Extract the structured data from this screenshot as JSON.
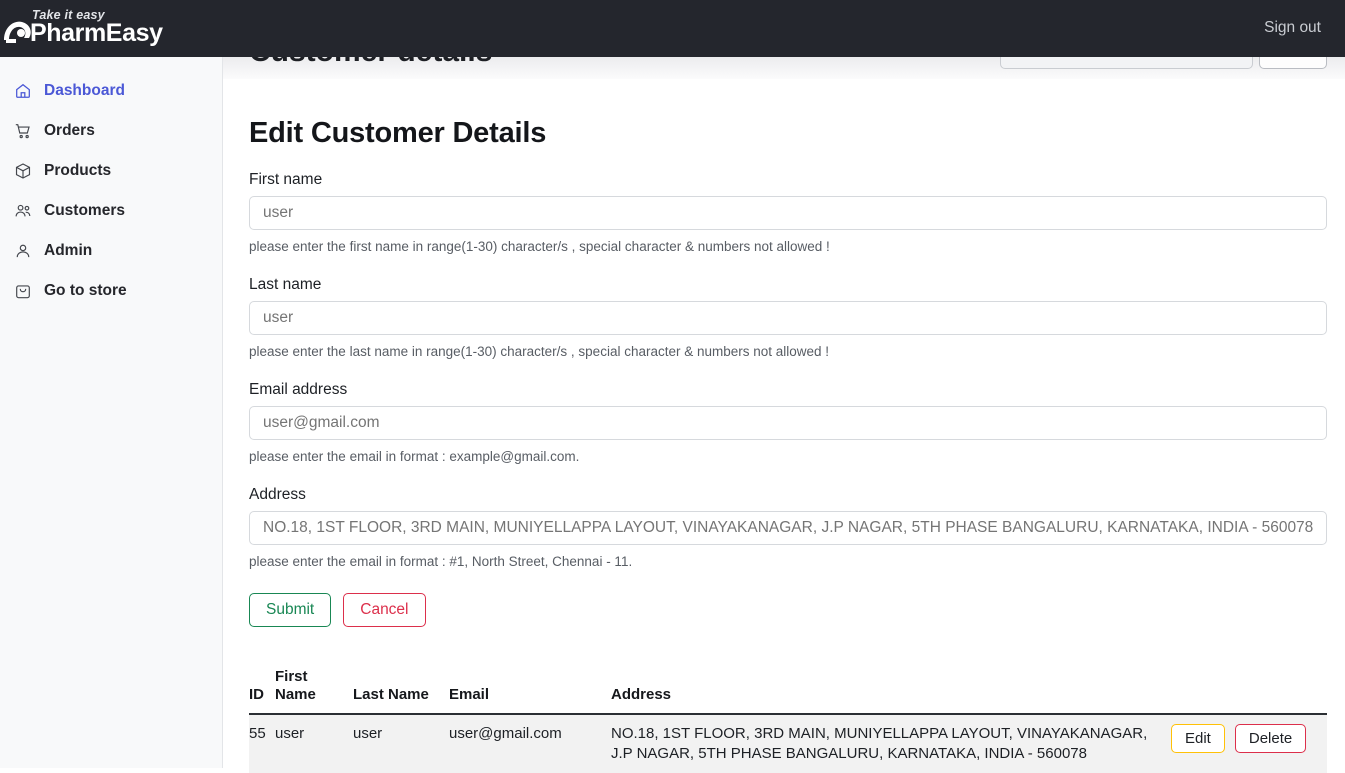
{
  "header": {
    "brand_tagline": "Take it easy",
    "brand_name": "PharmEasy",
    "signout_label": "Sign out"
  },
  "sidebar": {
    "items": [
      {
        "label": "Dashboard",
        "icon": "home-icon",
        "active": true
      },
      {
        "label": "Orders",
        "icon": "cart-icon",
        "active": false
      },
      {
        "label": "Products",
        "icon": "box-icon",
        "active": false
      },
      {
        "label": "Customers",
        "icon": "users-icon",
        "active": false
      },
      {
        "label": "Admin",
        "icon": "user-icon",
        "active": false
      },
      {
        "label": "Go to store",
        "icon": "bag-icon",
        "active": false
      }
    ]
  },
  "page": {
    "title": "Customer details"
  },
  "form": {
    "title": "Edit Customer Details",
    "fields": [
      {
        "label": "First name",
        "value": "user",
        "placeholder": "user",
        "help": "please enter the first name in range(1-30) character/s , special character & numbers not allowed !"
      },
      {
        "label": "Last name",
        "value": "user",
        "placeholder": "user",
        "help": "please enter the last name in range(1-30) character/s , special character & numbers not allowed !"
      },
      {
        "label": "Email address",
        "value": "user@gmail.com",
        "placeholder": "user@gmail.com",
        "help": "please enter the email in format : example@gmail.com."
      },
      {
        "label": "Address",
        "value": "NO.18, 1ST FLOOR, 3RD MAIN, MUNIYELLAPPA LAYOUT, VINAYAKANAGAR, J.P NAGAR, 5TH PHASE BANGALURU, KARNATAKA, INDIA - 560078",
        "placeholder": "NO.18, 1ST FLOOR, 3RD MAIN, MUNIYELLAPPA LAYOUT, VINAYAKANAGAR, J.P NAGAR, 5TH PHASE BANGALURU, KARNATAKA, INDIA - 560078",
        "help": "please enter the email in format : #1, North Street, Chennai - 11."
      }
    ],
    "submit_label": "Submit",
    "cancel_label": "Cancel"
  },
  "table": {
    "columns": {
      "id": "ID",
      "first_name": "First Name",
      "last_name": "Last Name",
      "email": "Email",
      "address": "Address"
    },
    "rows": [
      {
        "id": "55",
        "first_name": "user",
        "last_name": "user",
        "email": "user@gmail.com",
        "address": "NO.18, 1ST FLOOR, 3RD MAIN, MUNIYELLAPPA LAYOUT, VINAYAKANAGAR, J.P NAGAR, 5TH PHASE BANGALURU, KARNATAKA, INDIA - 560078",
        "edit_label": "Edit",
        "delete_label": "Delete"
      }
    ]
  },
  "colors": {
    "topbar": "#24262d",
    "sidebar_bg": "#f8f9fa",
    "active_nav": "#4b58d6",
    "submit": "#198754",
    "cancel": "#dc2f4b",
    "edit": "#ffc107",
    "delete": "#dc2f4b"
  }
}
